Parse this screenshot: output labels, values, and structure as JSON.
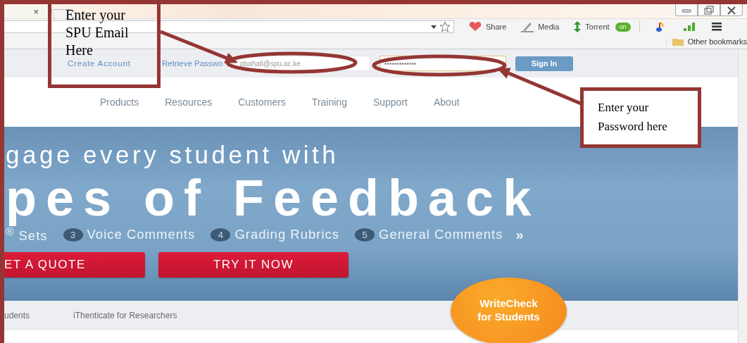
{
  "browser": {
    "tab": {
      "close": "×",
      "selected": true
    },
    "toolbar": [
      {
        "kind": "heart",
        "label": "Share"
      },
      {
        "kind": "pen",
        "label": "Media"
      },
      {
        "kind": "updown",
        "label": "Torrent"
      }
    ],
    "toggle": {
      "label": "on",
      "on": true
    },
    "bookmarks": [
      "Other bookmarks"
    ]
  },
  "site": {
    "links": [
      "Create Account",
      "Retrieve Passwo"
    ],
    "email": {
      "value": "pbahati@spu.ac.ke"
    },
    "password": {
      "value": "•••••••••••••",
      "focused": true
    },
    "sign_in": "Sign In",
    "nav": [
      "Products",
      "Resources",
      "Customers",
      "Training",
      "Support",
      "About"
    ],
    "hero": {
      "headline": "gage every student with",
      "title": "pes of Feedback",
      "features": [
        {
          "label": "$^{®}$ Sets"
        },
        {
          "number": "3",
          "label": "Voice Comments"
        },
        {
          "number": "4",
          "label": "Grading Rubrics"
        },
        {
          "number": "5",
          "label": "General Comments"
        }
      ],
      "more": "»",
      "buttons": [
        "ET A QUOTE",
        "TRY IT NOW"
      ]
    },
    "subnav": [
      "udents",
      "iThenticate for Researchers"
    ],
    "badge": "WriteCheck for Students"
  },
  "callouts": [
    {
      "text": "Enter your SPU Email Here"
    },
    {
      "text": "Enter your Password here"
    }
  ]
}
